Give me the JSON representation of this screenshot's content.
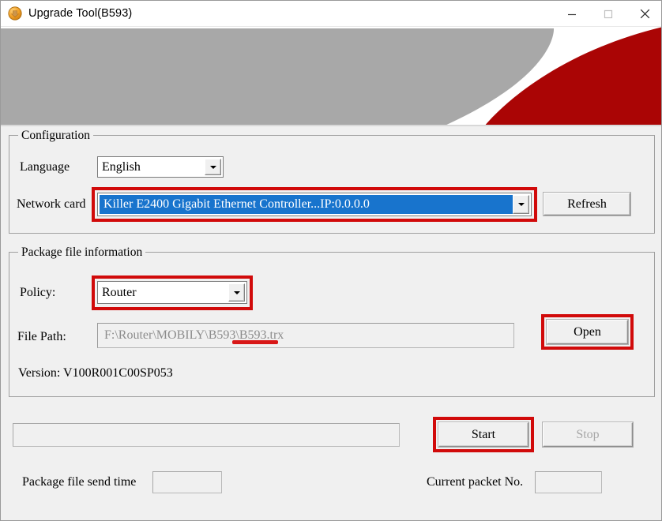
{
  "window": {
    "title": "Upgrade Tool(B593)",
    "app_icon": "upgrade-download-icon",
    "controls": {
      "minimize": "minimize-icon",
      "maximize": "maximize-icon",
      "close": "close-icon"
    }
  },
  "banner": {
    "gray_color": "#a8a8a8",
    "red_color": "#aa0505",
    "background": "#ffffff"
  },
  "configuration": {
    "group_title": "Configuration",
    "language": {
      "label": "Language",
      "value": "English",
      "options": [
        "English"
      ]
    },
    "network_card": {
      "label": "Network card",
      "value": "Killer E2400 Gigabit Ethernet Controller...IP:0.0.0.0",
      "options": [
        "Killer E2400 Gigabit Ethernet Controller...IP:0.0.0.0"
      ],
      "selected": true,
      "highlight_color": "#1874cd"
    },
    "refresh_button": "Refresh"
  },
  "package": {
    "group_title": "Package file information",
    "policy": {
      "label": "Policy:",
      "value": "Router",
      "options": [
        "Router"
      ]
    },
    "file_path": {
      "label": "File Path:",
      "value": "F:\\Router\\MOBILY\\B593\\B593.trx",
      "placeholder": ""
    },
    "open_button": "Open",
    "version": "Version: V100R001C00SP053"
  },
  "progress": {
    "value": "",
    "percent": 0
  },
  "actions": {
    "start_button": "Start",
    "stop_button": "Stop",
    "stop_disabled": true
  },
  "status": {
    "send_time_label": "Package file send time",
    "send_time_value": "",
    "packet_no_label": "Current packet No.",
    "packet_no_value": ""
  },
  "annotations": {
    "accent_red": "#d10a0a",
    "underline_red": "#d81717"
  }
}
